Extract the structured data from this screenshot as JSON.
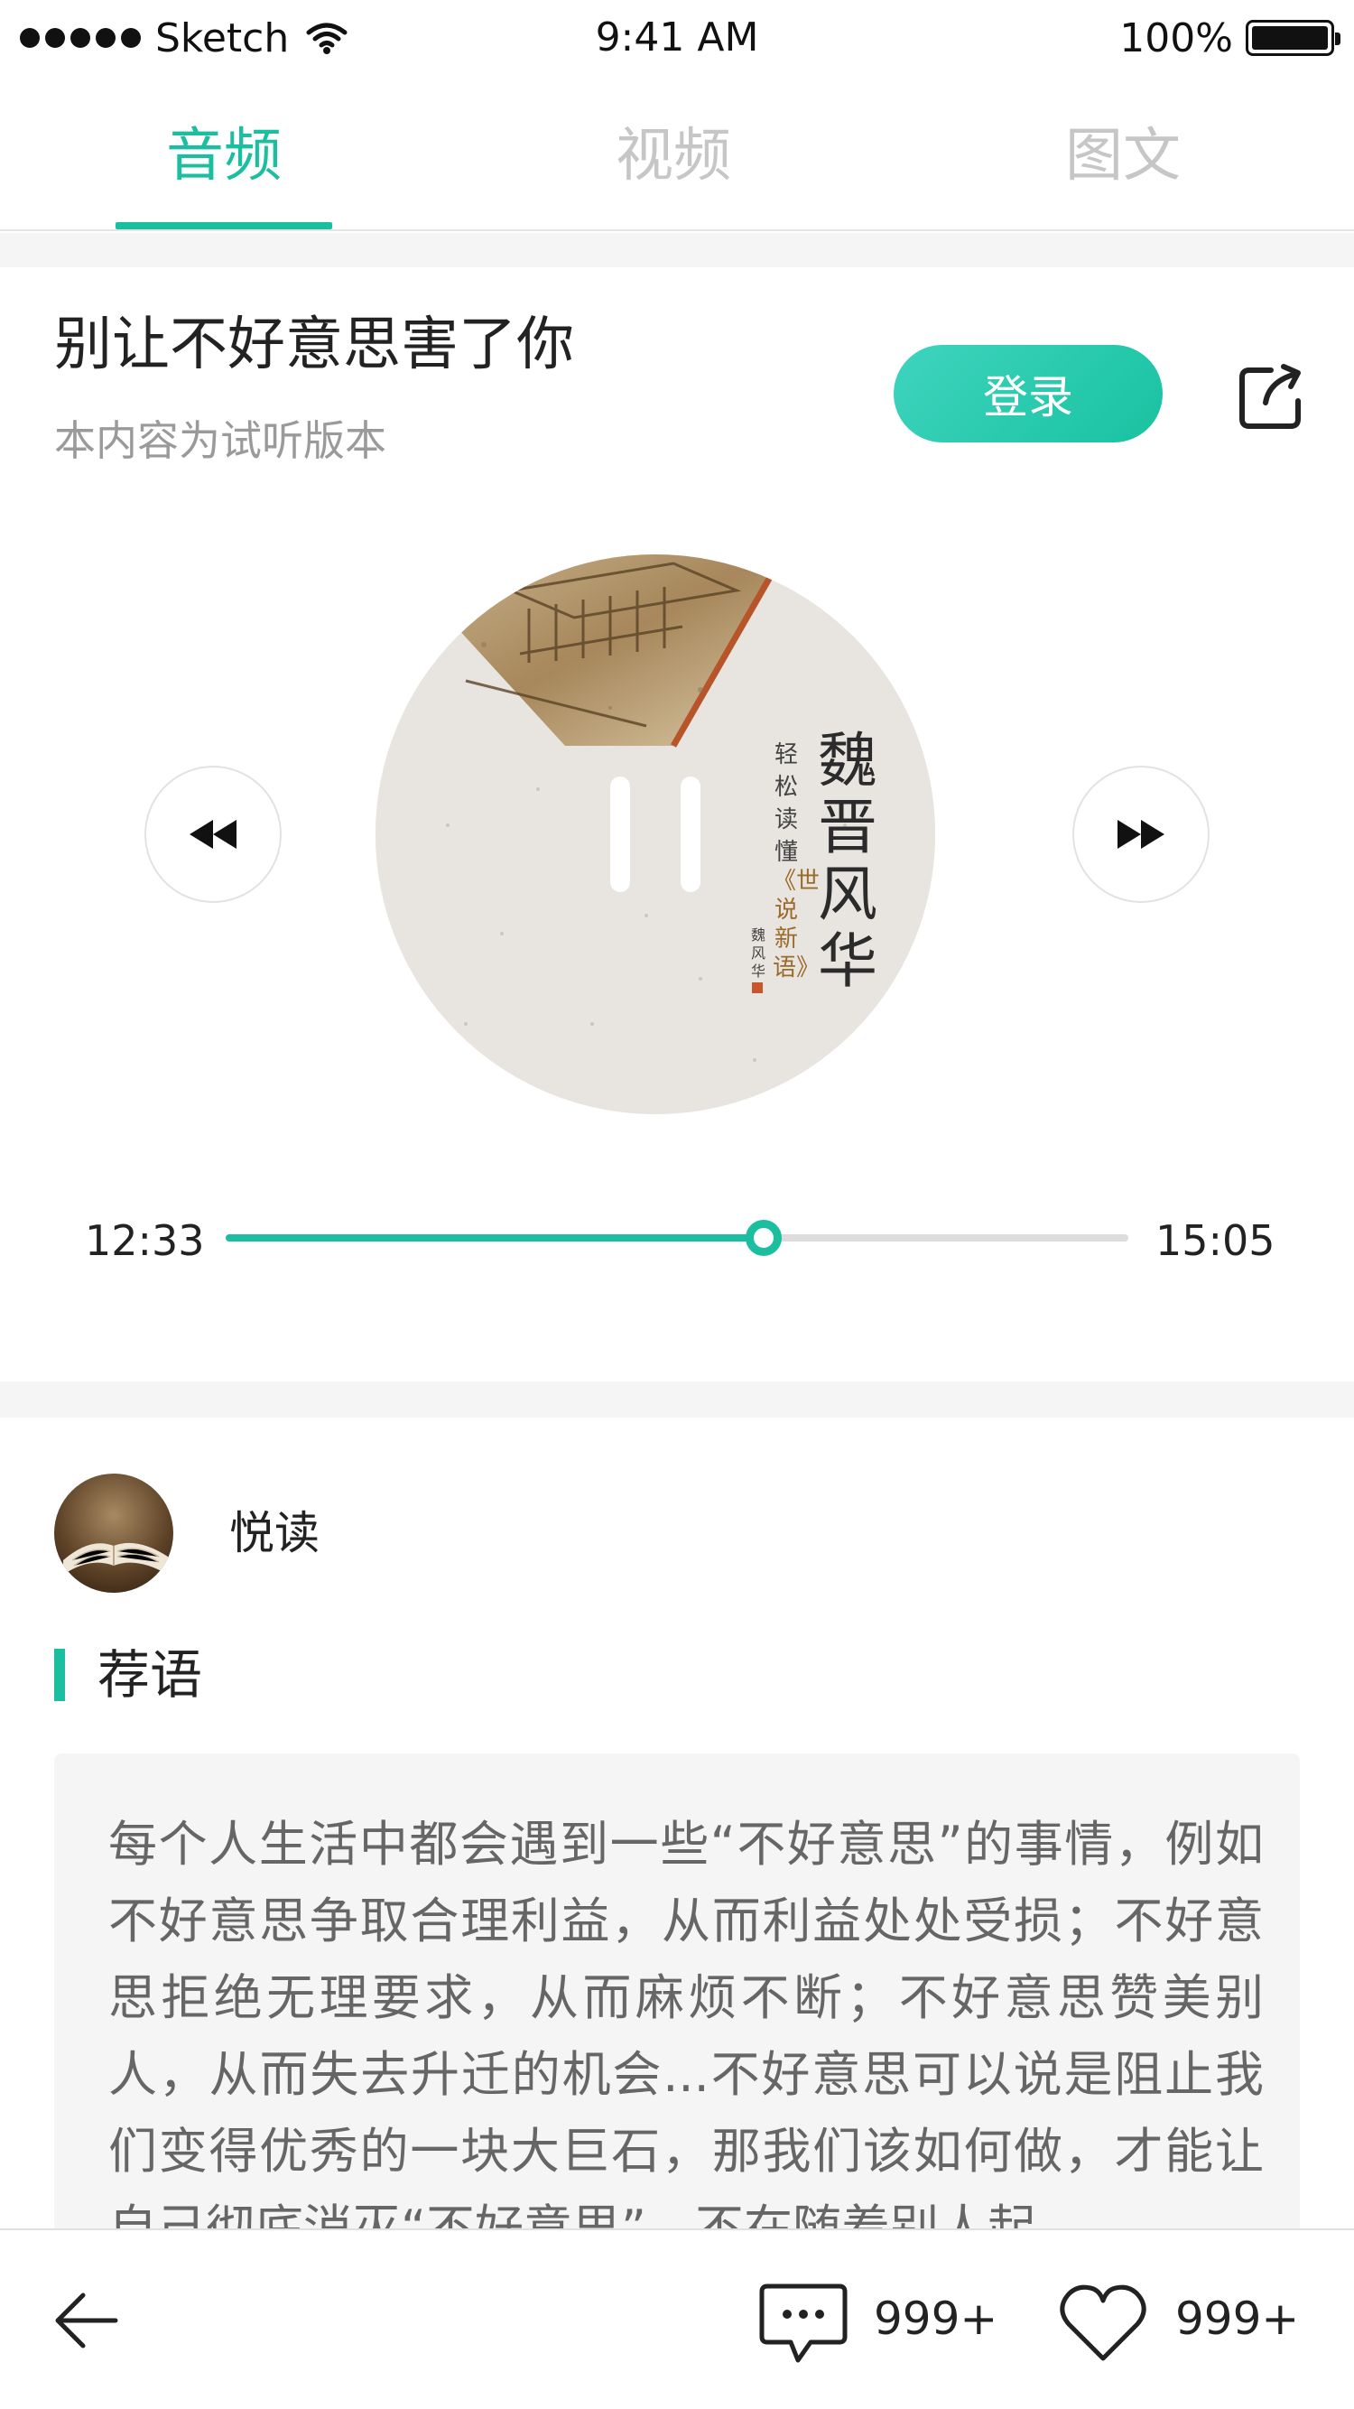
{
  "status_bar": {
    "carrier": "Sketch",
    "time": "9:41 AM",
    "battery": "100%",
    "icons": [
      "signal-dots",
      "wifi-icon",
      "battery-icon"
    ]
  },
  "tabs": [
    {
      "label": "音频",
      "active": true
    },
    {
      "label": "视频",
      "active": false
    },
    {
      "label": "图文",
      "active": false
    }
  ],
  "header": {
    "title": "别让不好意思害了你",
    "subtitle": "本内容为试听版本",
    "login_label": "登录",
    "share_icon": "share-icon"
  },
  "player": {
    "cover": {
      "title_chars": "魏晋风华",
      "sub_chars": "轻松读懂",
      "book_chars": "《世说新语》",
      "author_chars": "魏风华"
    },
    "state": "playing",
    "current_time": "12:33",
    "total_time": "15:05",
    "progress": 0.596,
    "prev_icon": "rewind-icon",
    "next_icon": "fast-forward-icon",
    "pause_icon": "pause-icon"
  },
  "author": {
    "name": "悦读",
    "avatar_icon": "book-avatar"
  },
  "recommend": {
    "heading": "荐语",
    "text": "每个人生活中都会遇到一些“不好意思”的事情，例如不好意思争取合理利益，从而利益处处受损；不好意思拒绝无理要求，从而麻烦不断；不好意思赞美别人，从而失去升迁的机会...不好意思可以说是阻止我们变得优秀的一块大巨石，那我们该如何做，才能让自己彻底消灭“不好意思”，不在随着别人起"
  },
  "bottom_bar": {
    "back_icon": "back-arrow-icon",
    "comment_icon": "comment-icon",
    "comment_count": "999+",
    "like_icon": "heart-icon",
    "like_count": "999+"
  },
  "colors": {
    "accent": "#1bbf9f",
    "tab_inactive": "#c6c6c6",
    "subtle_text": "#9a9a9a",
    "band": "#f5f5f5"
  }
}
